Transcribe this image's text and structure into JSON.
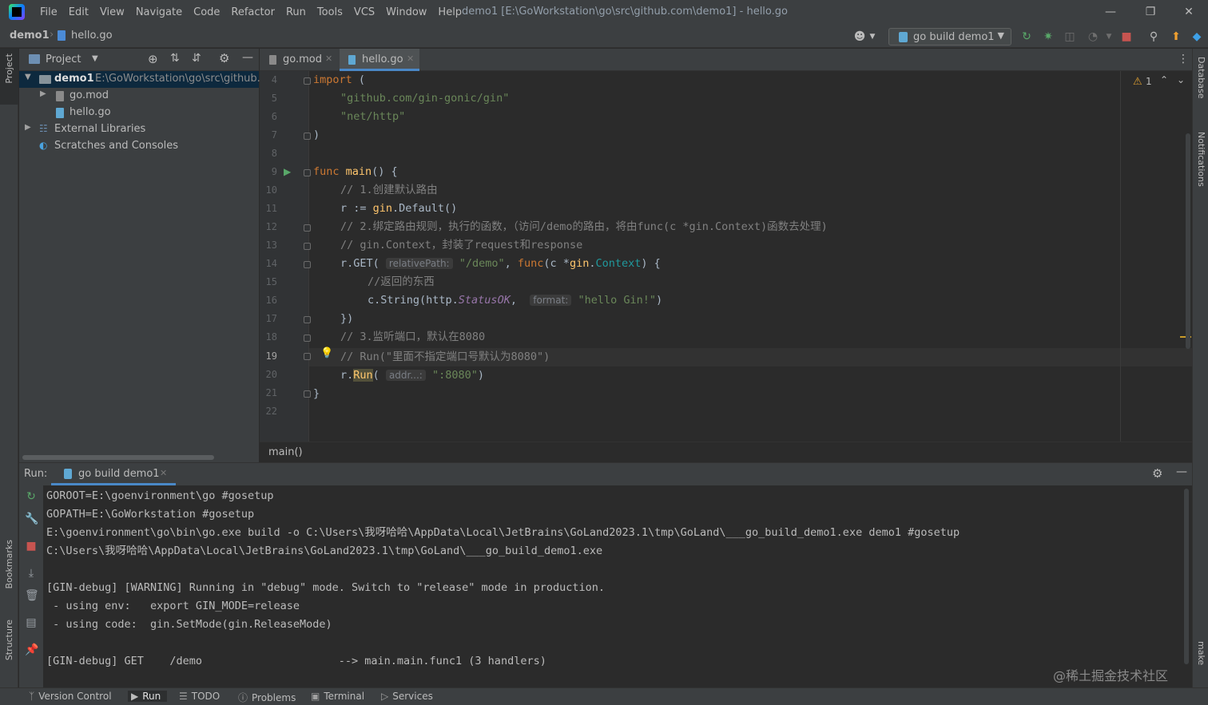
{
  "titlebar": {
    "menu": [
      "File",
      "Edit",
      "View",
      "Navigate",
      "Code",
      "Refactor",
      "Run",
      "Tools",
      "VCS",
      "Window",
      "Help"
    ],
    "window_title": "demo1 [E:\\GoWorkstation\\go\\src\\github.com\\demo1] - hello.go"
  },
  "navbar": {
    "project": "demo1",
    "file": "hello.go",
    "run_config": "go build demo1",
    "warning_count": "1"
  },
  "left_strip": {
    "project_tab": "Project",
    "bookmarks_tab": "Bookmarks",
    "structure_tab": "Structure"
  },
  "right_strip": {
    "database_tab": "Database",
    "notifications_tab": "Notifications",
    "make_tab": "make"
  },
  "project_panel": {
    "title": "Project",
    "root_name": "demo1",
    "root_path": "E:\\GoWorkstation\\go\\src\\github.c",
    "files": [
      "go.mod",
      "hello.go"
    ],
    "external": "External Libraries",
    "scratches": "Scratches and Consoles"
  },
  "editor": {
    "tabs": [
      "go.mod",
      "hello.go"
    ],
    "active_tab": "hello.go",
    "line_numbers": [
      "4",
      "5",
      "6",
      "7",
      "8",
      "9",
      "10",
      "11",
      "12",
      "13",
      "14",
      "15",
      "16",
      "17",
      "18",
      "19",
      "20",
      "21",
      "22"
    ],
    "current_line": "19",
    "code": {
      "l4_kw": "import",
      "l4_rest": " (",
      "l5": "\"github.com/gin-gonic/gin\"",
      "l6": "\"net/http\"",
      "l7": ")",
      "l9_kw": "func",
      "l9_fn": "main",
      "l9_rest": "() {",
      "l10": "// 1.创建默认路由",
      "l11_a": "r := ",
      "l11_b": "gin",
      "l11_c": ".Default()",
      "l12": "// 2.绑定路由规则，执行的函数，（访问/demo的路由，将由func(c *gin.Context)函数去处理)",
      "l13": "// gin.Context，封装了request和response",
      "l14_a": "r.GET(",
      "l14_hint": "relativePath:",
      "l14_str": "\"/demo\"",
      "l14_b": ", ",
      "l14_kw": "func",
      "l14_c": "(c *",
      "l14_d": "gin",
      "l14_e": ".",
      "l14_ty": "Context",
      "l14_f": ") {",
      "l15": "//返回的东西",
      "l16_a": "c.String(",
      "l16_b": "http.",
      "l16_it": "StatusOK",
      "l16_c": ",",
      "l16_hint": "format:",
      "l16_str": "\"hello Gin!\"",
      "l16_d": ")",
      "l17": "})",
      "l18": "// 3.监听端口，默认在8080",
      "l19": "// Run(\"里面不指定端口号默认为8080\")",
      "l20_a": "r.",
      "l20_run": "Run",
      "l20_b": "(",
      "l20_hint": "addr...:",
      "l20_str": "\":8080\"",
      "l20_c": ")",
      "l21": "}"
    },
    "breadcrumb": "main()"
  },
  "run_panel": {
    "label": "Run:",
    "tab": "go build demo1",
    "console": [
      "GOROOT=E:\\goenvironment\\go #gosetup",
      "GOPATH=E:\\GoWorkstation #gosetup",
      "E:\\goenvironment\\go\\bin\\go.exe build -o C:\\Users\\我呀哈哈\\AppData\\Local\\JetBrains\\GoLand2023.1\\tmp\\GoLand\\___go_build_demo1.exe demo1 #gosetup",
      "C:\\Users\\我呀哈哈\\AppData\\Local\\JetBrains\\GoLand2023.1\\tmp\\GoLand\\___go_build_demo1.exe",
      "",
      "[GIN-debug] [WARNING] Running in \"debug\" mode. Switch to \"release\" mode in production.",
      " - using env:   export GIN_MODE=release",
      " - using code:  gin.SetMode(gin.ReleaseMode)",
      "",
      "[GIN-debug] GET    /demo                     --> main.main.func1 (3 handlers)"
    ],
    "watermark": "@稀土掘金技术社区"
  },
  "bottom_bar": {
    "items": [
      "Version Control",
      "Run",
      "TODO",
      "Problems",
      "Terminal",
      "Services"
    ]
  },
  "colors": {
    "accent": "#4a88c7",
    "keyword": "#cc7832",
    "string": "#6a8759",
    "function": "#ffc66d"
  }
}
